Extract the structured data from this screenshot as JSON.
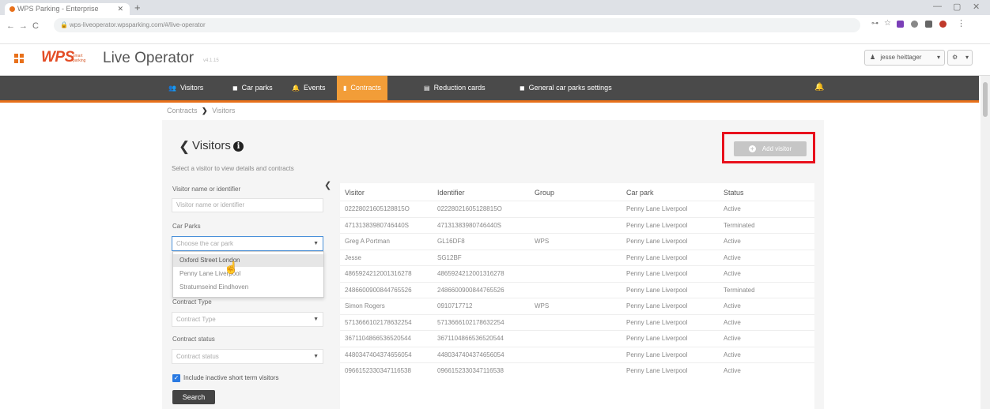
{
  "browser": {
    "tab_title": "WPS Parking - Enterprise",
    "url": "wps-liveoperator.wpsparking.com/#/live-operator",
    "window_controls": [
      "—",
      "▢",
      "✕"
    ]
  },
  "app": {
    "logo": "WPS",
    "logo_sub": "smart parking",
    "title": "Live Operator",
    "version": "v4.1.15",
    "user": "jesse heittager",
    "settings_label": "⚙"
  },
  "nav": {
    "items": [
      {
        "label": "Visitors",
        "icon": "users-icon",
        "glyph": "👥"
      },
      {
        "label": "Car parks",
        "icon": "car-park-icon",
        "glyph": "◼"
      },
      {
        "label": "Events",
        "icon": "bell-icon",
        "glyph": "🔔"
      },
      {
        "label": "Contracts",
        "icon": "contract-icon",
        "glyph": "▮"
      },
      {
        "label": "Reduction cards",
        "icon": "card-icon",
        "glyph": "▤"
      },
      {
        "label": "General car parks settings",
        "icon": "settings-icon",
        "glyph": "◼"
      }
    ],
    "active": "Contracts"
  },
  "breadcrumb": {
    "parent": "Contracts",
    "separator": "❯",
    "current": "Visitors"
  },
  "page": {
    "back": "❮",
    "title": "Visitors",
    "info_icon": "i",
    "hint": "Select a visitor to view details and contracts",
    "add_button": "Add visitor"
  },
  "filters": {
    "visitor_label": "Visitor name or identifier",
    "visitor_placeholder": "Visitor name or identifier",
    "carparks_label": "Car Parks",
    "carparks_placeholder": "Choose the car park",
    "carpark_options": [
      "Oxford Street London",
      "Penny Lane Liverpool",
      "Stratumseind Eindhoven"
    ],
    "contract_type_label": "Contract Type",
    "contract_type_placeholder": "Contract Type",
    "contract_status_label": "Contract status",
    "contract_status_placeholder": "Contract status",
    "include_inactive_label": "Include inactive short term visitors",
    "include_inactive_checked": true,
    "search_button": "Search"
  },
  "table": {
    "headers": [
      "Visitor",
      "Identifier",
      "Group",
      "Car park",
      "Status"
    ],
    "rows": [
      [
        "02228021605128815O",
        "02228021605128815O",
        "",
        "Penny Lane Liverpool",
        "Active"
      ],
      [
        "47131383980746440S",
        "47131383980746440S",
        "",
        "Penny Lane Liverpool",
        "Terminated"
      ],
      [
        "Greg A Portman",
        "GL16DF8",
        "WPS",
        "Penny Lane Liverpool",
        "Active"
      ],
      [
        "Jesse",
        "SG12BF",
        "",
        "Penny Lane Liverpool",
        "Active"
      ],
      [
        "4865924212001316278",
        "4865924212001316278",
        "",
        "Penny Lane Liverpool",
        "Active"
      ],
      [
        "2486600900844765526",
        "2486600900844765526",
        "",
        "Penny Lane Liverpool",
        "Terminated"
      ],
      [
        "Simon Rogers",
        "0910717712",
        "WPS",
        "Penny Lane Liverpool",
        "Active"
      ],
      [
        "5713666102178632254",
        "5713666102178632254",
        "",
        "Penny Lane Liverpool",
        "Active"
      ],
      [
        "3671104866536520544",
        "3671104866536520544",
        "",
        "Penny Lane Liverpool",
        "Active"
      ],
      [
        "4480347404374656054",
        "4480347404374656054",
        "",
        "Penny Lane Liverpool",
        "Active"
      ],
      [
        "0966152330347116538",
        "0966152330347116538",
        "",
        "Penny Lane Liverpool",
        "Active"
      ]
    ]
  }
}
